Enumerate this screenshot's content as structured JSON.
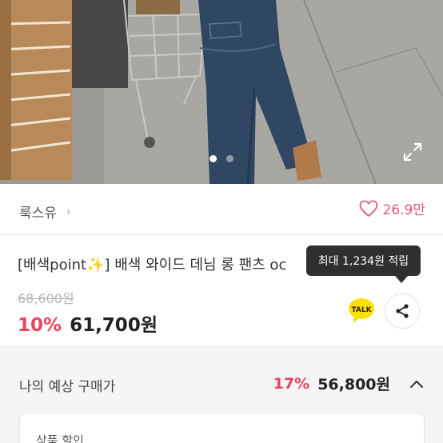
{
  "hero": {
    "image_desc_icon": "product-photo",
    "carousel_total": 2,
    "carousel_active": 1
  },
  "store": {
    "name": "룩스유",
    "chevron": "›",
    "like_count": "26.9만"
  },
  "product": {
    "title_prefix": "[배색point",
    "title_emoji": "✨",
    "title_suffix": "] 배색 와이드 데님 롱 팬츠 oc",
    "original_price": "68,600원",
    "discount_rate": "10%",
    "price": "61,700원"
  },
  "tooltip": {
    "text": "최대 1,234원 적립"
  },
  "talk": {
    "label": "TALK"
  },
  "expected": {
    "label": "나의 예상 구매가",
    "discount_rate": "17%",
    "price": "56,800원"
  },
  "discount_card": {
    "label": "상품 할인"
  },
  "colors": {
    "accent_pink": "#e84560",
    "like_pink": "#e05a78",
    "talk_yellow": "#fae100",
    "tooltip_bg": "#2f2f2f"
  }
}
